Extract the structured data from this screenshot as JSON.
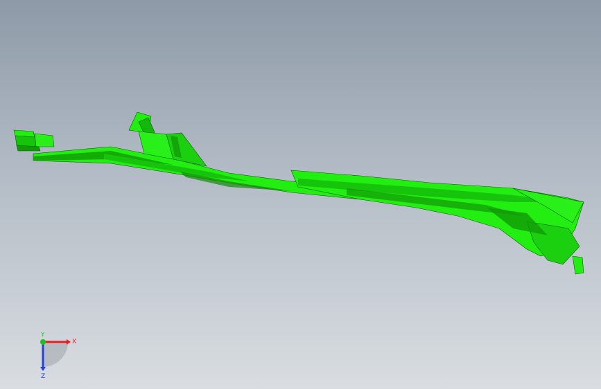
{
  "viewport": {
    "background_top": "#8e9aa8",
    "background_bottom": "#d9dde1",
    "model": {
      "name": "green-surface-body",
      "color": "#22ee11",
      "shade": "#11a80a",
      "edge_color": "#0a5c05"
    }
  },
  "triad": {
    "x_label": "X",
    "y_label": "Y",
    "z_label": "Z",
    "x_color": "#e02020",
    "y_color": "#20c020",
    "z_color": "#2040e0"
  }
}
